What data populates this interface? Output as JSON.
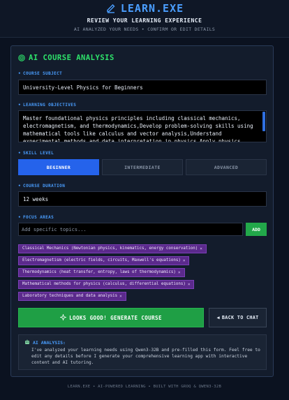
{
  "header": {
    "logo_icon": "pencil-icon",
    "logo_text": "LEARN.EXE",
    "subtitle": "REVIEW YOUR LEARNING EXPERIENCE",
    "tagline": "AI ANALYZED YOUR NEEDS • CONFIRM OR EDIT DETAILS"
  },
  "card": {
    "title_icon": "target-icon",
    "title": "AI COURSE ANALYSIS",
    "subject": {
      "label": "COURSE SUBJECT",
      "value": "University-Level Physics for Beginners"
    },
    "objectives": {
      "label": "LEARNING OBJECTIVES",
      "value": "Master foundational physics principles including classical mechanics, electromagnetism, and thermodynamics,Develop problem-solving skills using mathematical tools like calculus and vector analysis,Understand experimental methods and data interpretation in physics,Apply physics concepts to real-"
    },
    "skill": {
      "label": "SKILL LEVEL",
      "options": [
        "BEGINNER",
        "INTERMEDIATE",
        "ADVANCED"
      ],
      "selected": "BEGINNER"
    },
    "duration": {
      "label": "COURSE DURATION",
      "value": "12 weeks"
    },
    "focus": {
      "label": "FOCUS AREAS",
      "placeholder": "Add specific topics...",
      "add_label": "ADD",
      "tags": [
        "Classical Mechanics (Newtonian physics, kinematics, energy conservation)",
        "Electromagnetism (electric fields, circuits, Maxwell's equations)",
        "Thermodynamics (heat transfer, entropy, laws of thermodynamics)",
        "Mathematical methods for physics (calculus, differential equations)",
        "Laboratory techniques and data analysis"
      ],
      "remove_glyph": "×"
    },
    "generate_label": "LOOKS GOOD! GENERATE COURSE",
    "generate_icon": "sparkle-icon",
    "back_label": "BACK TO CHAT",
    "back_glyph": "◀",
    "analysis": {
      "icon": "robot-icon",
      "heading": "AI ANALYSIS:",
      "body": "I've analyzed your learning needs using Qwen3-32B and pre-filled this form. Feel free to edit any details before I generate your comprehensive learning app with interactive content and AI tutoring."
    }
  },
  "footer": "LEARN.EXE • AI-POWERED LEARNING • BUILT WITH GROQ & QWEN3-32B",
  "colors": {
    "background": "#0b1220",
    "accent_blue": "#4a9eff",
    "accent_green": "#2ee36b",
    "tag_purple": "#5b2a8c",
    "button_green": "#1f9f45",
    "selected_blue": "#2563eb"
  }
}
